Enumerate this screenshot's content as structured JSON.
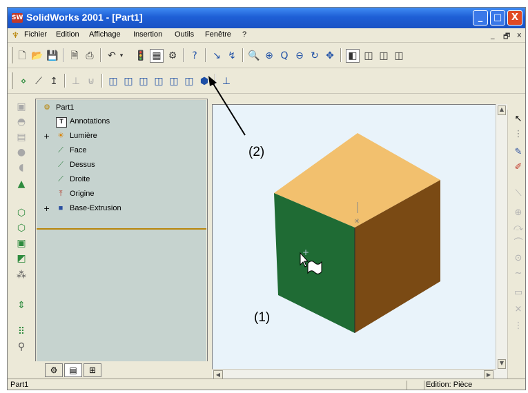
{
  "window": {
    "app_icon": "SW",
    "title": "SolidWorks 2001 - [Part1]",
    "controls": [
      "_",
      "□",
      "X"
    ]
  },
  "menu": {
    "items": [
      "Fichier",
      "Edition",
      "Affichage",
      "Insertion",
      "Outils",
      "Fenêtre",
      "?"
    ],
    "mdi_controls": [
      "_",
      "🗗",
      "x"
    ]
  },
  "feature_tree": {
    "root": "Part1",
    "items": [
      {
        "label": "Annotations",
        "icon": "annotations-icon"
      },
      {
        "label": "Lumière",
        "icon": "light-icon"
      },
      {
        "label": "Face",
        "icon": "plane-icon"
      },
      {
        "label": "Dessus",
        "icon": "plane-icon"
      },
      {
        "label": "Droite",
        "icon": "plane-icon"
      },
      {
        "label": "Origine",
        "icon": "origin-icon"
      },
      {
        "label": "Base-Extrusion",
        "icon": "extrusion-icon"
      }
    ]
  },
  "callouts": {
    "one": "(1)",
    "two": "(2)"
  },
  "model": {
    "top_color": "#f2c06e",
    "left_color": "#1f6b34",
    "right_color": "#7a4a14"
  },
  "status": {
    "left": "Part1",
    "right": "Edition: Pièce"
  }
}
